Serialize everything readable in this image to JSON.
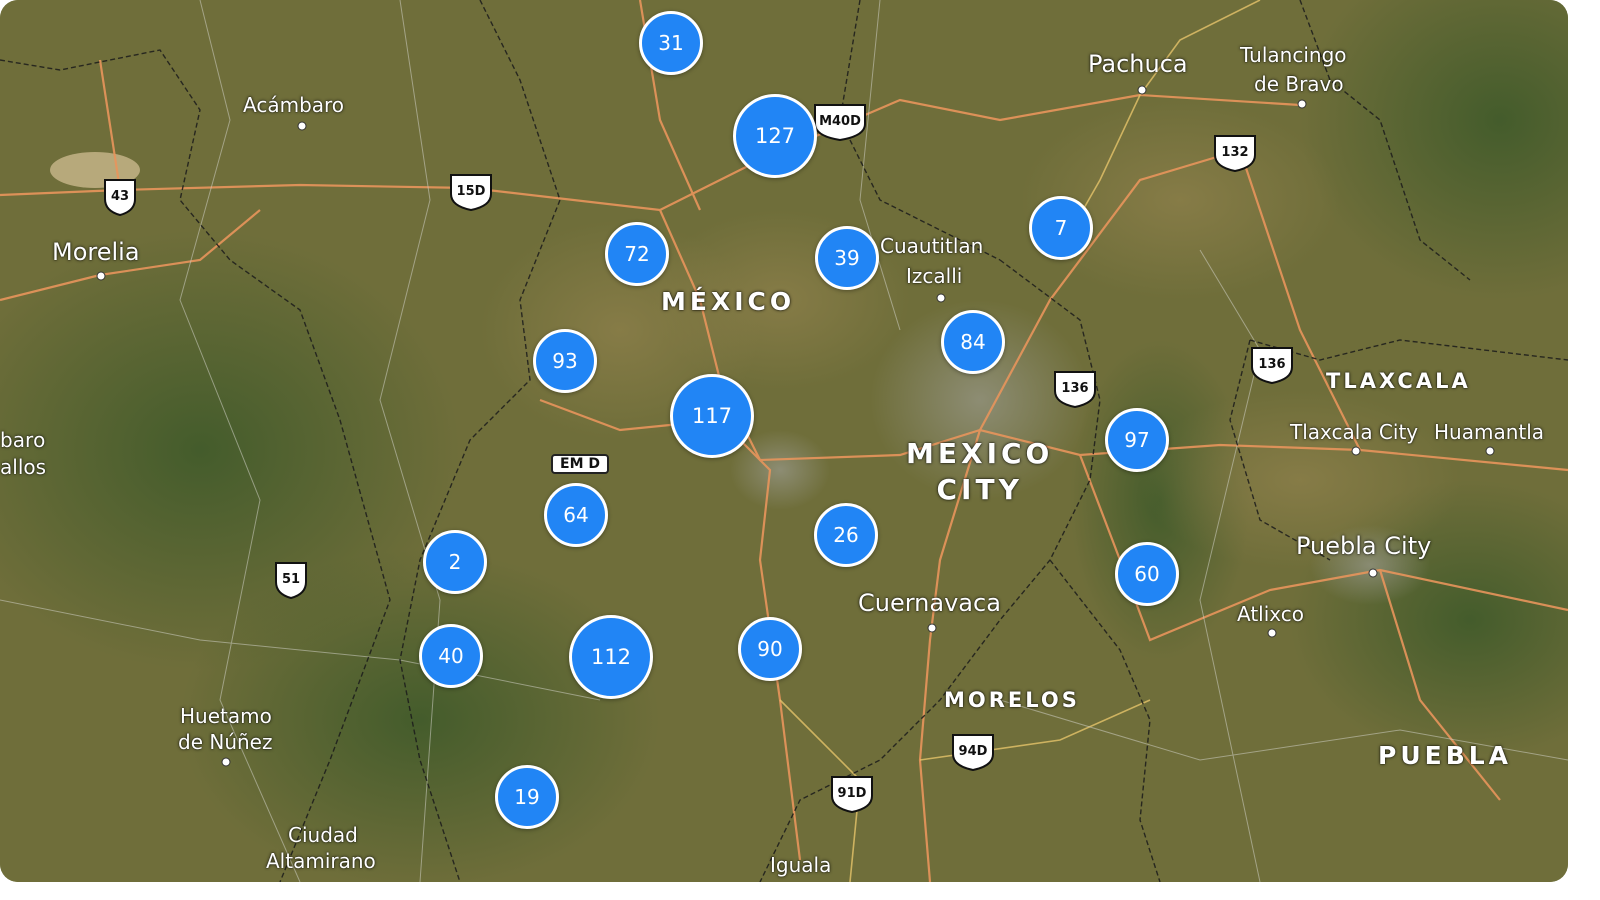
{
  "colors": {
    "cluster_fill": "#2185f5",
    "cluster_border": "#ffffff",
    "road": "#e8955c",
    "border": "#1b1b1b"
  },
  "places": {
    "pachuca": "Pachuca",
    "tulancingo": "Tulancingo",
    "tulancingo2": "de Bravo",
    "acambaro": "Acámbaro",
    "morelia": "Morelia",
    "cuautitlan": "Cuautitlan",
    "cuautitlan2": "Izcalli",
    "mexico_state": "MÉXICO",
    "mexico_city_1": "MEXICO",
    "mexico_city_2": "CITY",
    "tlaxcala_state": "TLAXCALA",
    "tlaxcala_city": "Tlaxcala City",
    "huamantla": "Huamantla",
    "puebla_city": "Puebla City",
    "puebla_state": "PUEBLA",
    "atlixco": "Atlixco",
    "cuernavaca": "Cuernavaca",
    "morelos_state": "MORELOS",
    "huetamo": "Huetamo",
    "huetamo2": "de Núñez",
    "ciudad_alt": "Ciudad",
    "ciudad_alt2": "Altamirano",
    "iguala": "Iguala",
    "edge_left1": "barо",
    "edge_left2": "allos"
  },
  "shields": {
    "s43": "43",
    "s15d": "15D",
    "s132": "132",
    "s136a": "136",
    "s136b": "136",
    "s51": "51",
    "s94d": "94D",
    "s91d": "91D",
    "sm40d": "M40D",
    "emd": "EM D"
  },
  "clusters": {
    "c31": "31",
    "c127": "127",
    "c72": "72",
    "c39": "39",
    "c7": "7",
    "c93": "93",
    "c84": "84",
    "c117": "117",
    "c97": "97",
    "c64": "64",
    "c26": "26",
    "c2": "2",
    "c60": "60",
    "c40": "40",
    "c112": "112",
    "c90": "90",
    "c19": "19"
  }
}
